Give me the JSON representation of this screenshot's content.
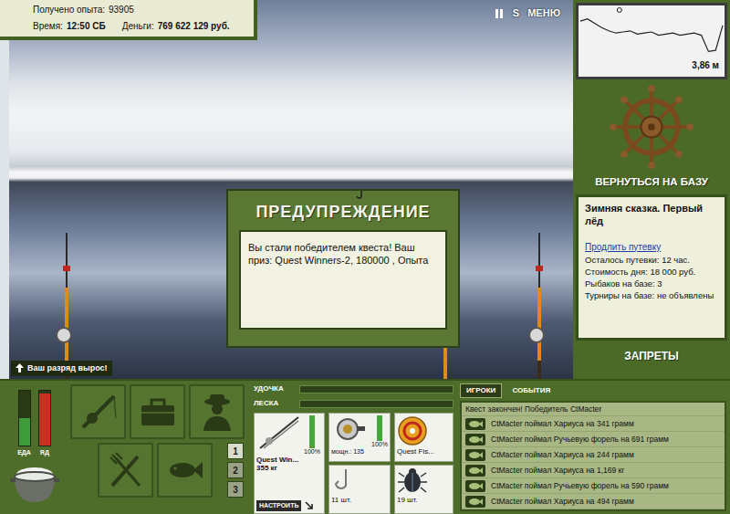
{
  "hud": {
    "experience": {
      "label": "Получено опыта:",
      "value": "93905"
    },
    "time": {
      "label": "Время:",
      "value": "12:50 СБ"
    },
    "money": {
      "label": "Деньги:",
      "value": "769 622 129 руб."
    }
  },
  "top_menu": {
    "sound": "S",
    "menu": "МЕНЮ"
  },
  "scene": {
    "notice": "Ваш разряд вырос!"
  },
  "dialog": {
    "title": "ПРЕДУПРЕЖДЕНИЕ",
    "message": "Вы стали победителем квеста! Ваш приз: Quest Winners-2, 180000 , Опыта"
  },
  "depth_chart": {
    "profile": [
      1.1,
      0.9,
      1.3,
      1.7,
      2.0,
      2.2,
      2.1,
      2.0,
      2.3,
      2.2,
      2.1,
      2.4,
      2.3,
      2.2,
      2.4,
      2.3,
      2.2,
      2.4,
      3.9,
      3.8,
      1.5
    ],
    "float_level": 0.28,
    "reading": "3,86 м"
  },
  "base": {
    "return_label": "ВЕРНУТЬСЯ НА БАЗУ",
    "title": "Зимняя сказка. Первый лёд",
    "extend_link": "Продлить путевку",
    "facts": [
      "Осталось путевки: 12 час.",
      "Стоимость дня: 18 000 руб.",
      "Рыбаков на базе: 3",
      "Турниры на базе: не объявлены"
    ],
    "bans_label": "ЗАПРЕТЫ"
  },
  "meters": [
    {
      "name": "ЕДА",
      "level": 0.5,
      "color": "#3d9b3a"
    },
    {
      "name": "ЯД",
      "level": 0.95,
      "color": "#d32b22"
    }
  ],
  "slots": [
    {
      "label": "1",
      "selected": true
    },
    {
      "label": "2",
      "selected": false
    },
    {
      "label": "3",
      "selected": false
    }
  ],
  "tension": [
    {
      "label": "УДОЧКА",
      "level": 0
    },
    {
      "label": "ЛЕСКА",
      "level": 0
    }
  ],
  "tackle": {
    "rod": {
      "name": "Quest Win...",
      "detail": "355 кг",
      "condition": "100%",
      "level": 1,
      "button": "НАСТРОИТЬ"
    },
    "reel": {
      "detail": "мощн.: 135",
      "condition": "100%",
      "level": 1
    },
    "line": {
      "name": "Quest Fis..."
    },
    "hook": {
      "detail": "11 шт."
    },
    "bait": {
      "detail": "19 шт."
    }
  },
  "chat": {
    "tabs": [
      {
        "label": "ИГРОКИ",
        "selected": true
      },
      {
        "label": "СОБЫТИЯ",
        "selected": false
      }
    ],
    "messages": [
      {
        "kind": "notice",
        "text": "Квест закончен! Победитель CtMacter"
      },
      {
        "kind": "catch",
        "text": "CtMacter поймал Хариуса на 341 грамм"
      },
      {
        "kind": "catch",
        "text": "CtMacter поймал Ручьевую форель на 691 грамм"
      },
      {
        "kind": "catch",
        "text": "CtMacter поймал Хариуса на 244 грамм"
      },
      {
        "kind": "catch",
        "text": "CtMacter поймал Хариуса на 1,169 кг"
      },
      {
        "kind": "catch",
        "text": "CtMacter поймал Ручьевую форель на 590 грамм"
      },
      {
        "kind": "catch",
        "text": "CtMacter поймал Хариуса на 494 грамм"
      }
    ]
  }
}
